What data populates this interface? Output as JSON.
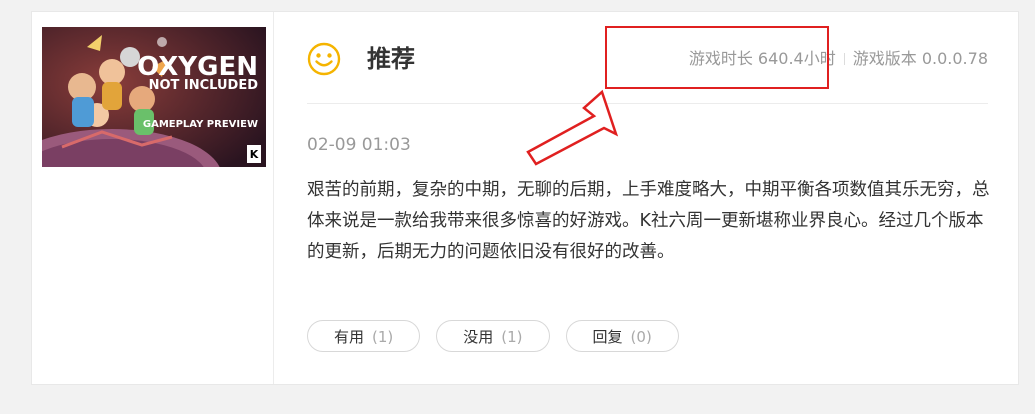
{
  "game": {
    "cover_title_line1": "OXYGEN",
    "cover_title_line2": "NOT INCLUDED",
    "cover_caption": "GAMEPLAY PREVIEW",
    "cover_badge": "K"
  },
  "review": {
    "verdict": "推荐",
    "verdict_icon": "smiley-face-icon",
    "play_time_label": "游戏时长 640.4小时",
    "version_label": "游戏版本 0.0.0.78",
    "datetime": "02-09 01:03",
    "text": "艰苦的前期，复杂的中期，无聊的后期，上手难度略大，中期平衡各项数值其乐无穷，总体来说是一款给我带来很多惊喜的好游戏。K社六周一更新堪称业界良心。经过几个版本的更新，后期无力的问题依旧没有很好的改善。"
  },
  "actions": {
    "useful_label": "有用",
    "useful_count": "(1)",
    "useless_label": "没用",
    "useless_count": "(1)",
    "reply_label": "回复",
    "reply_count": "(0)"
  },
  "colors": {
    "accent_yellow": "#f5b400",
    "annotation_red": "#e02020",
    "text_primary": "#333333",
    "text_secondary": "#999999"
  }
}
